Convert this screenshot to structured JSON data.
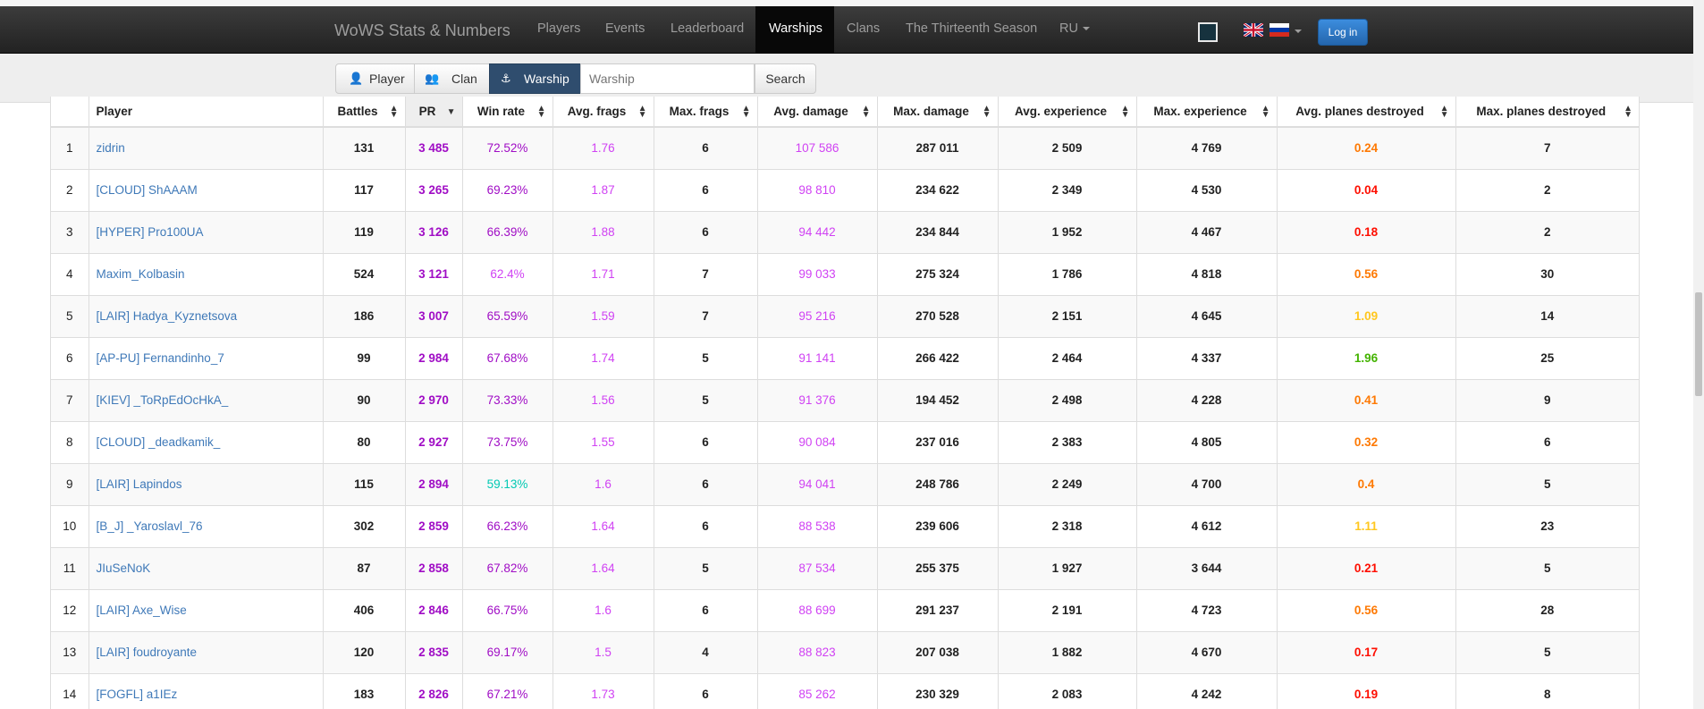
{
  "navbar": {
    "brand": "WoWS Stats & Numbers",
    "items": [
      "Players",
      "Events",
      "Leaderboard",
      "Warships",
      "Clans",
      "The Thirteenth Season",
      "RU"
    ],
    "active": "Warships",
    "login_label": "Log in"
  },
  "search": {
    "tabs": [
      "Player",
      "Clan",
      "Warship"
    ],
    "active_tab": "Warship",
    "placeholder": "Warship",
    "button_label": "Search"
  },
  "table": {
    "headers": [
      "",
      "Player",
      "Battles",
      "PR",
      "Win rate",
      "Avg. frags",
      "Max. frags",
      "Avg. damage",
      "Max. damage",
      "Avg. experience",
      "Max. experience",
      "Avg. planes destroyed",
      "Max. planes destroyed"
    ],
    "sorted_column": "PR",
    "rows": [
      {
        "rank": "1",
        "player": "zidrin",
        "battles": "131",
        "pr": "3 485",
        "winrate": "72.52%",
        "avg_frags": "1.76",
        "max_frags": "6",
        "avg_damage": "107 586",
        "max_damage": "287 011",
        "avg_exp": "2 509",
        "max_exp": "4 769",
        "avg_planes": "0.24",
        "max_planes": "7"
      },
      {
        "rank": "2",
        "player": "[CLOUD] ShAAAM",
        "battles": "117",
        "pr": "3 265",
        "winrate": "69.23%",
        "avg_frags": "1.87",
        "max_frags": "6",
        "avg_damage": "98 810",
        "max_damage": "234 622",
        "avg_exp": "2 349",
        "max_exp": "4 530",
        "avg_planes": "0.04",
        "max_planes": "2"
      },
      {
        "rank": "3",
        "player": "[HYPER] Pro100UA",
        "battles": "119",
        "pr": "3 126",
        "winrate": "66.39%",
        "avg_frags": "1.88",
        "max_frags": "6",
        "avg_damage": "94 442",
        "max_damage": "234 844",
        "avg_exp": "1 952",
        "max_exp": "4 467",
        "avg_planes": "0.18",
        "max_planes": "2"
      },
      {
        "rank": "4",
        "player": "Maxim_Kolbasin",
        "battles": "524",
        "pr": "3 121",
        "winrate": "62.4%",
        "avg_frags": "1.71",
        "max_frags": "7",
        "avg_damage": "99 033",
        "max_damage": "275 324",
        "avg_exp": "1 786",
        "max_exp": "4 818",
        "avg_planes": "0.56",
        "max_planes": "30"
      },
      {
        "rank": "5",
        "player": "[LAIR] Hadya_Kyznetsova",
        "battles": "186",
        "pr": "3 007",
        "winrate": "65.59%",
        "avg_frags": "1.59",
        "max_frags": "7",
        "avg_damage": "95 216",
        "max_damage": "270 528",
        "avg_exp": "2 151",
        "max_exp": "4 645",
        "avg_planes": "1.09",
        "max_planes": "14"
      },
      {
        "rank": "6",
        "player": "[AP-PU] Fernandinho_7",
        "battles": "99",
        "pr": "2 984",
        "winrate": "67.68%",
        "avg_frags": "1.74",
        "max_frags": "5",
        "avg_damage": "91 141",
        "max_damage": "266 422",
        "avg_exp": "2 464",
        "max_exp": "4 337",
        "avg_planes": "1.96",
        "max_planes": "25"
      },
      {
        "rank": "7",
        "player": "[KIEV] _ToRpEdOcHkA_",
        "battles": "90",
        "pr": "2 970",
        "winrate": "73.33%",
        "avg_frags": "1.56",
        "max_frags": "5",
        "avg_damage": "91 376",
        "max_damage": "194 452",
        "avg_exp": "2 498",
        "max_exp": "4 228",
        "avg_planes": "0.41",
        "max_planes": "9"
      },
      {
        "rank": "8",
        "player": "[CLOUD] _deadkamik_",
        "battles": "80",
        "pr": "2 927",
        "winrate": "73.75%",
        "avg_frags": "1.55",
        "max_frags": "6",
        "avg_damage": "90 084",
        "max_damage": "237 016",
        "avg_exp": "2 383",
        "max_exp": "4 805",
        "avg_planes": "0.32",
        "max_planes": "6"
      },
      {
        "rank": "9",
        "player": "[LAIR] Lapindos",
        "battles": "115",
        "pr": "2 894",
        "winrate": "59.13%",
        "avg_frags": "1.6",
        "max_frags": "6",
        "avg_damage": "94 041",
        "max_damage": "248 786",
        "avg_exp": "2 249",
        "max_exp": "4 700",
        "avg_planes": "0.4",
        "max_planes": "5"
      },
      {
        "rank": "10",
        "player": "[B_J] _Yaroslavl_76",
        "battles": "302",
        "pr": "2 859",
        "winrate": "66.23%",
        "avg_frags": "1.64",
        "max_frags": "6",
        "avg_damage": "88 538",
        "max_damage": "239 606",
        "avg_exp": "2 318",
        "max_exp": "4 612",
        "avg_planes": "1.11",
        "max_planes": "23"
      },
      {
        "rank": "11",
        "player": "JIuSeNoK",
        "battles": "87",
        "pr": "2 858",
        "winrate": "67.82%",
        "avg_frags": "1.64",
        "max_frags": "5",
        "avg_damage": "87 534",
        "max_damage": "255 375",
        "avg_exp": "1 927",
        "max_exp": "3 644",
        "avg_planes": "0.21",
        "max_planes": "5"
      },
      {
        "rank": "12",
        "player": "[LAIR] Axe_Wise",
        "battles": "406",
        "pr": "2 846",
        "winrate": "66.75%",
        "avg_frags": "1.6",
        "max_frags": "6",
        "avg_damage": "88 699",
        "max_damage": "291 237",
        "avg_exp": "2 191",
        "max_exp": "4 723",
        "avg_planes": "0.56",
        "max_planes": "28"
      },
      {
        "rank": "13",
        "player": "[LAIR] foudroyante",
        "battles": "120",
        "pr": "2 835",
        "winrate": "69.17%",
        "avg_frags": "1.5",
        "max_frags": "4",
        "avg_damage": "88 823",
        "max_damage": "207 038",
        "avg_exp": "1 882",
        "max_exp": "4 670",
        "avg_planes": "0.17",
        "max_planes": "5"
      },
      {
        "rank": "14",
        "player": "[FOGFL] a1IEz",
        "battles": "183",
        "pr": "2 826",
        "winrate": "67.21%",
        "avg_frags": "1.73",
        "max_frags": "6",
        "avg_damage": "85 262",
        "max_damage": "230 329",
        "avg_exp": "2 083",
        "max_exp": "4 242",
        "avg_planes": "0.19",
        "max_planes": "8"
      }
    ]
  },
  "colors": {
    "super_unicum": "#a00dc5",
    "unicum_light": "#d042f3",
    "great": "#02c9b3",
    "very_bad": "#fe0e00",
    "bad": "#fe7903",
    "below_avg": "#ffc71f",
    "good": "#44b300",
    "link": "#3f79b8"
  },
  "cell_colors": {
    "pr": "#a00dc5",
    "winrate": [
      "#a00dc5",
      "#a00dc5",
      "#a00dc5",
      "#d042f3",
      "#a00dc5",
      "#a00dc5",
      "#a00dc5",
      "#a00dc5",
      "#02c9b3",
      "#a00dc5",
      "#a00dc5",
      "#a00dc5",
      "#a00dc5",
      "#a00dc5"
    ],
    "avg_frags": "#d042f3",
    "avg_damage": "#d042f3",
    "avg_planes": [
      "#fe7903",
      "#fe0e00",
      "#fe0e00",
      "#fe7903",
      "#ffc71f",
      "#44b300",
      "#fe7903",
      "#fe7903",
      "#fe7903",
      "#ffc71f",
      "#fe0e00",
      "#fe7903",
      "#fe0e00",
      "#fe0e00"
    ]
  }
}
